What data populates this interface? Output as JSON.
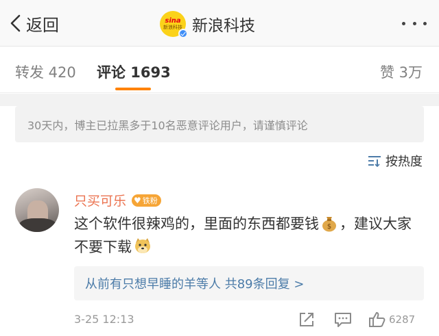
{
  "nav": {
    "back_label": "返回",
    "account_name": "新浪科技",
    "logo_top": "sina",
    "logo_sub": "新浪科技"
  },
  "tabs": {
    "repost": "转发 420",
    "comments": "评论 1693",
    "likes": "赞 3万",
    "active": "comments"
  },
  "notice": "30天内，博主已拉黑多于10名恶意评论用户，请谨慎评论",
  "sort_label": "按热度",
  "comment": {
    "username": "只买可乐",
    "fan_badge": "铁粉",
    "text_part1": "这个软件很辣鸡的，里面的东西都要钱",
    "text_part2": "，建议大家不要下载",
    "emoji_1": "money-bag-icon",
    "emoji_2": "doge-icon",
    "replies": "从前有只想早睡的羊等人 共89条回复 >",
    "timestamp": "3-25 12:13",
    "like_count": "6287"
  },
  "colors": {
    "username": "#eb7350",
    "link": "#4b7ba8",
    "tab_indicator": "#ff8200",
    "fan_badge": "#f6a536",
    "logo_bg": "#fbd21a"
  }
}
